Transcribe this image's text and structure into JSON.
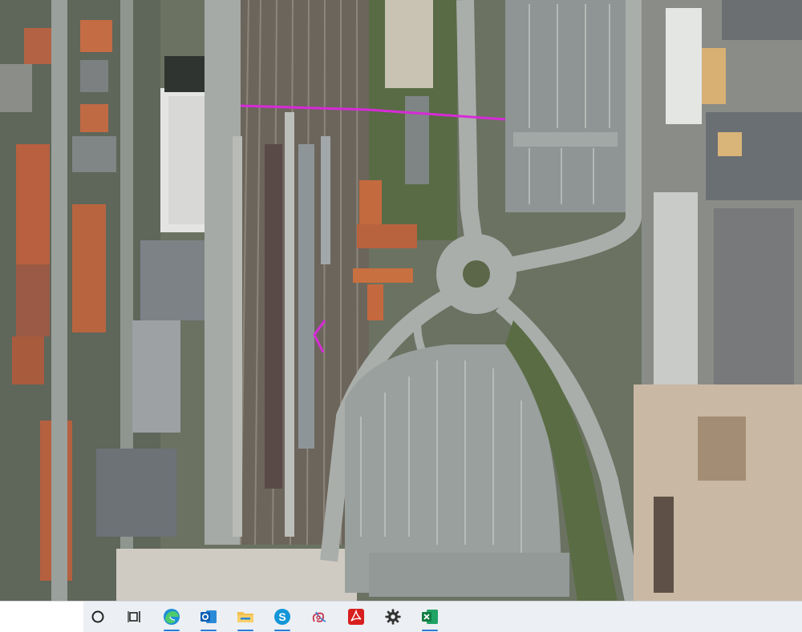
{
  "map": {
    "view": "aerial-photo",
    "annotations": [
      {
        "type": "drawn-line",
        "color": "#d62bd6"
      },
      {
        "type": "drawn-chevron",
        "color": "#d62bd6"
      }
    ]
  },
  "taskbar": {
    "search_area_background": "#ffffff",
    "buttons": [
      {
        "id": "cortana",
        "icon": "cortana-circle-icon",
        "active": false
      },
      {
        "id": "task-view",
        "icon": "task-view-icon",
        "active": false
      },
      {
        "id": "edge",
        "icon": "edge-icon",
        "active": true
      },
      {
        "id": "outlook",
        "icon": "outlook-icon",
        "active": true
      },
      {
        "id": "file-explorer",
        "icon": "folder-icon",
        "active": true
      },
      {
        "id": "skype",
        "icon": "skype-icon",
        "active": true
      },
      {
        "id": "snip",
        "icon": "snip-sketch-icon",
        "active": false
      },
      {
        "id": "acrobat",
        "icon": "acrobat-pdf-icon",
        "active": false
      },
      {
        "id": "settings",
        "icon": "gear-icon",
        "active": false
      },
      {
        "id": "excel",
        "icon": "excel-icon",
        "active": true
      }
    ]
  },
  "colors": {
    "accent": "#2b7bd4",
    "annotation": "#d62bd6",
    "taskbar_bg": "#eceff3"
  }
}
